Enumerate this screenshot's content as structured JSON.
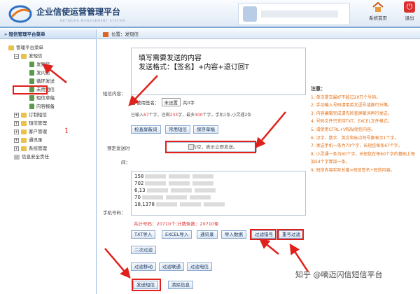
{
  "header": {
    "title": "企业信使运营管理平台",
    "subtitle": "NETWORK MANAGEMENT SYSTEM",
    "home_label": "系统首页",
    "exit_label": "退出"
  },
  "sidebar": {
    "title": "» 短信管理平台菜单",
    "root": "管理平台菜单",
    "items": [
      {
        "label": "发短信",
        "level": 1,
        "open": true
      },
      {
        "label": "发短信",
        "level": 2
      },
      {
        "label": "发闪信",
        "level": 2
      },
      {
        "label": "循环发送",
        "level": 2
      },
      {
        "label": "未用短信",
        "level": 2
      },
      {
        "label": "短信草稿",
        "level": 2
      },
      {
        "label": "内容报备",
        "level": 2
      },
      {
        "label": "订制短信",
        "level": 1
      },
      {
        "label": "短信管理",
        "level": 1
      },
      {
        "label": "客户管理",
        "level": 1
      },
      {
        "label": "通讯录",
        "level": 1
      },
      {
        "label": "系统管理",
        "level": 1
      },
      {
        "label": "信息安全责任",
        "level": 1
      }
    ],
    "annotation": "1"
  },
  "breadcrumb": "位置：发短信",
  "form": {
    "content_label": "短信内容：",
    "content_line1": "填写需要发送的内容",
    "content_line2": "发送格式：【签名】+内容+退订回T",
    "use_sign": "使用签名：",
    "sign_select": "未设置",
    "sign_count": "共0字",
    "count_prefix": "已输入",
    "count_a": "67",
    "count_mid1": "个字，还剩",
    "count_b": "233",
    "count_mid2": "字，最多",
    "count_c": "300",
    "count_suffix": "个字，手机1条,小灵通2条",
    "btn_check": "检查屏蔽词",
    "btn_common": "常用短信",
    "btn_save": "保存草稿",
    "schedule_label": "预定发送时",
    "schedule_label2": "间：",
    "schedule_placeholder": "若为空，表示立即发送。",
    "phone_label": "手机号码：",
    "phones": [
      "158",
      "702",
      "6,13",
      "70",
      "18,1378"
    ],
    "total": "共计号码：20710个;计费条数：20710条",
    "btn_txt": "TXT导入",
    "btn_excel": "EXCEL导入",
    "btn_contacts": "通讯录",
    "btn_import": "导入数据",
    "btn_filter_wrong": "过滤错号",
    "btn_filter_dup": "重号过滤",
    "btn_second": "二次过滤",
    "btn_mobile": "过滤移动",
    "btn_unicom": "过滤联通",
    "btn_telecom": "过滤电信",
    "btn_send": "发送短信",
    "btn_clear": "清除信息"
  },
  "notes": {
    "title": "注意：",
    "items": [
      "1. 单次提交最好不超过20万个号码。",
      "2. 手动输入号码请用英文逗号或换行分隔。",
      "3. 内容编辑完成请先检查屏蔽词再行发送。",
      "4. 号码文件只支持TXT、EXCEL文件格式。",
      "5. 请使用CTRL+V粘贴短信内容。",
      "6. 汉字、数字、英文和标点符号都表示1个字。",
      "7. 发送手机一条为70个字，长短信每条67个字。",
      "8. 小灵通一条为60个字，长短信在每60个字的基础上每加54个字算加一条。",
      "9. 短信内容实际长度=短信签名+短信内容。"
    ]
  },
  "watermark": "知乎 @嘀迈闪信短信平台"
}
